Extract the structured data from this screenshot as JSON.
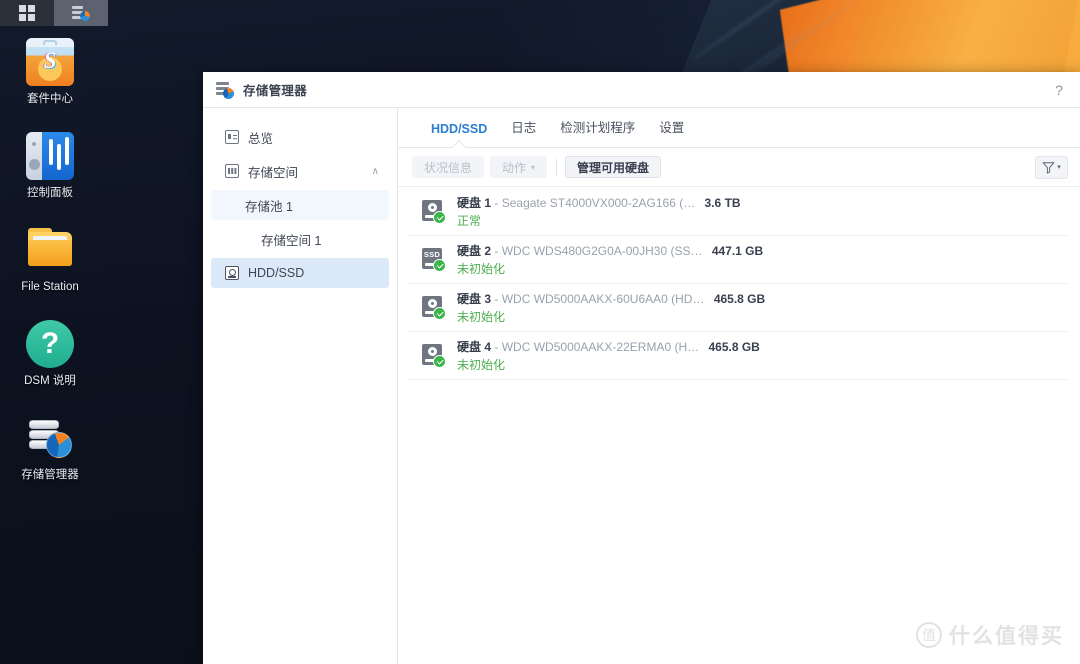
{
  "taskbar": {
    "apps_button": "apps-grid",
    "items": [
      {
        "name": "main-menu",
        "icon": "grid-icon",
        "active": false
      },
      {
        "name": "storage-manager",
        "icon": "storage-manager-icon",
        "active": true
      }
    ]
  },
  "desktop": {
    "icons": [
      {
        "label": "套件中心",
        "icon": "package-center-icon"
      },
      {
        "label": "控制面板",
        "icon": "control-panel-icon"
      },
      {
        "label": "File Station",
        "icon": "file-station-icon"
      },
      {
        "label": "DSM 说明",
        "icon": "dsm-help-icon"
      },
      {
        "label": "存储管理器",
        "icon": "storage-manager-icon"
      }
    ]
  },
  "window": {
    "title": "存储管理器",
    "help_label": "?"
  },
  "sidebar": {
    "items": [
      {
        "label": "总览",
        "icon": "overview-icon",
        "level": 0,
        "state": "normal"
      },
      {
        "label": "存储空间",
        "icon": "volume-icon",
        "level": 0,
        "state": "normal",
        "chevron": "∧"
      },
      {
        "label": "存储池 1",
        "icon": "",
        "level": 1,
        "state": "soft"
      },
      {
        "label": "存储空间 1",
        "icon": "",
        "level": 2,
        "state": "normal"
      },
      {
        "label": "HDD/SSD",
        "icon": "hdd-icon",
        "level": 0,
        "state": "selected"
      }
    ]
  },
  "tabs": [
    {
      "label": "HDD/SSD",
      "active": true
    },
    {
      "label": "日志",
      "active": false
    },
    {
      "label": "检测计划程序",
      "active": false
    },
    {
      "label": "设置",
      "active": false
    }
  ],
  "toolbar": {
    "health_info_label": "状况信息",
    "action_label": "动作",
    "action_caret": "▾",
    "manage_disks_label": "管理可用硬盘",
    "filter_icon": "filter-funnel-icon"
  },
  "disks": [
    {
      "label": "硬盘",
      "number": "1",
      "separator": "-",
      "model": "Seagate ST4000VX000-2AG166 (…",
      "size": "3.6 TB",
      "status": "正常",
      "type": "hdd"
    },
    {
      "label": "硬盘",
      "number": "2",
      "separator": "-",
      "model": "WDC WDS480G2G0A-00JH30 (SS…",
      "size": "447.1 GB",
      "status": "未初始化",
      "type": "ssd"
    },
    {
      "label": "硬盘",
      "number": "3",
      "separator": "-",
      "model": "WDC WD5000AAKX-60U6AA0 (HD…",
      "size": "465.8 GB",
      "status": "未初始化",
      "type": "hdd"
    },
    {
      "label": "硬盘",
      "number": "4",
      "separator": "-",
      "model": "WDC WD5000AAKX-22ERMA0 (H…",
      "size": "465.8 GB",
      "status": "未初始化",
      "type": "hdd"
    }
  ],
  "watermark": {
    "mark": "值",
    "text": "什么值得买"
  },
  "colors": {
    "accent_blue": "#2a7fd4",
    "status_green": "#4caf50",
    "selected_nav": "#dce9f8",
    "desktop_dark": "#0d1320",
    "wallpaper_orange": "#f5a93a"
  }
}
